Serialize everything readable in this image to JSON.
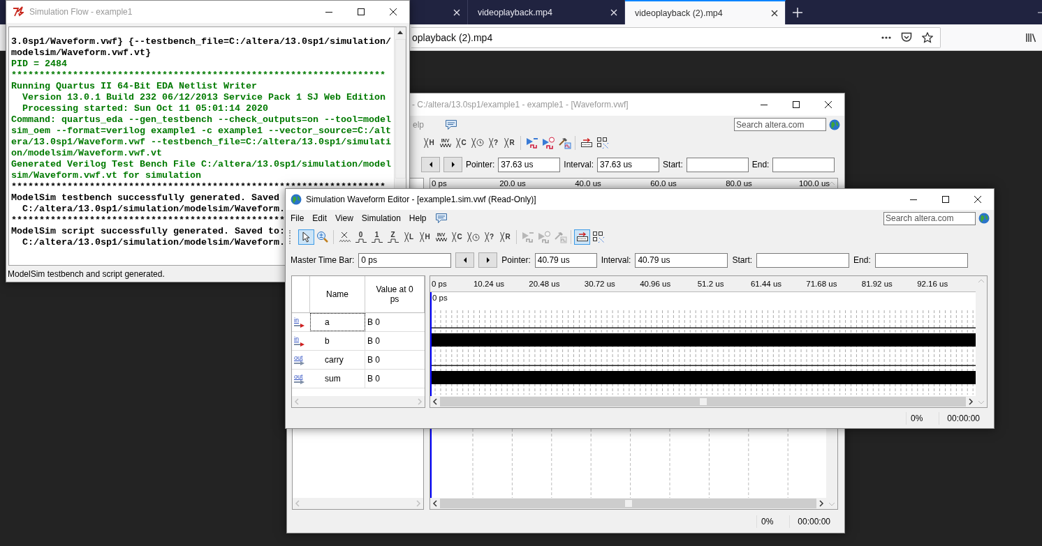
{
  "browser": {
    "tabs": [
      {
        "selected": false
      },
      {
        "label": "videoplayback.mp4",
        "selected": false
      },
      {
        "label": "videoplayback (2).mp4",
        "selected": true
      }
    ],
    "url": "oplayback (2).mp4"
  },
  "back_window": {
    "title": "- C:/altera/13.0sp1/example1 - example1 - [Waveform.vwf]",
    "menu": [
      "elp"
    ],
    "search": {
      "placeholder": "Search altera.com"
    },
    "toolbar": [
      {
        "kind": "letter",
        "glyph": "H",
        "selected": false,
        "disabled": false
      },
      {
        "kind": "invert",
        "glyph": "INV",
        "selected": false,
        "disabled": false
      },
      {
        "kind": "letter",
        "glyph": "C",
        "selected": false,
        "disabled": false
      },
      {
        "kind": "clock",
        "selected": false,
        "disabled": false
      },
      {
        "kind": "letter",
        "glyph": "?",
        "selected": false,
        "disabled": false
      },
      {
        "kind": "letter",
        "glyph": "R",
        "selected": false,
        "disabled": false
      },
      {
        "kind": "sep"
      },
      {
        "kind": "run-functional",
        "selected": false,
        "disabled": false
      },
      {
        "kind": "run-timing",
        "selected": false,
        "disabled": false
      },
      {
        "kind": "netlist",
        "selected": false,
        "disabled": false
      },
      {
        "kind": "sep"
      },
      {
        "kind": "snap",
        "selected": false,
        "disabled": false
      },
      {
        "kind": "grid",
        "selected": false,
        "disabled": false
      }
    ],
    "timebar": [
      {
        "kind": "prev"
      },
      {
        "kind": "next"
      },
      {
        "kind": "label",
        "text": "Pointer:"
      },
      {
        "kind": "field",
        "value": "37.63 us"
      },
      {
        "kind": "label",
        "text": "Interval:"
      },
      {
        "kind": "field",
        "value": "37.63 us"
      },
      {
        "kind": "label",
        "text": "Start:"
      },
      {
        "kind": "field"
      },
      {
        "kind": "label",
        "text": "End:"
      },
      {
        "kind": "field"
      }
    ],
    "ruler": [
      "0 ps",
      "20.0 us",
      "40.0 us",
      "60.0 us",
      "80.0 us",
      "100.0 us"
    ],
    "status": [
      "0%",
      "00:00:00"
    ]
  },
  "flow_window": {
    "title": "Simulation Flow - example1",
    "log": [
      {
        "kind": "plain",
        "text": "3.0sp1/Waveform.vwf} {--testbench_file=C:/altera/13.0sp1/simulation/"
      },
      {
        "kind": "plain",
        "text": "modelsim/Waveform.vwf.vt}"
      },
      {
        "kind": "info",
        "text": "PID = 2484"
      },
      {
        "kind": "info",
        "text": "*******************************************************************"
      },
      {
        "kind": "info",
        "text": "Running Quartus II 64-Bit EDA Netlist Writer"
      },
      {
        "kind": "info",
        "text": "  Version 13.0.1 Build 232 06/12/2013 Service Pack 1 SJ Web Edition"
      },
      {
        "kind": "info",
        "text": "  Processing started: Sun Oct 11 05:01:14 2020"
      },
      {
        "kind": "info",
        "text": "Command: quartus_eda --gen_testbench --check_outputs=on --tool=model"
      },
      {
        "kind": "info",
        "text": "sim_oem --format=verilog example1 -c example1 --vector_source=C:/alt"
      },
      {
        "kind": "info",
        "text": "era/13.0sp1/Waveform.vwf --testbench_file=C:/altera/13.0sp1/simulati"
      },
      {
        "kind": "info",
        "text": "on/modelsim/Waveform.vwf.vt"
      },
      {
        "kind": "info",
        "text": "Generated Verilog Test Bench File C:/altera/13.0sp1/simulation/model"
      },
      {
        "kind": "info",
        "text": "sim/Waveform.vwf.vt for simulation"
      },
      {
        "kind": "plain",
        "text": "*******************************************************************"
      },
      {
        "kind": "plain",
        "text": "ModelSim testbench successfully generated. Saved"
      },
      {
        "kind": "plain",
        "text": "  C:/altera/13.0sp1/simulation/modelsim/Waveform."
      },
      {
        "kind": "plain",
        "text": "*************************************************"
      },
      {
        "kind": "plain",
        "text": "ModelSim script successfully generated. Saved to:"
      },
      {
        "kind": "plain",
        "text": "  C:/altera/13.0sp1/simulation/modelsim/Waveform."
      }
    ],
    "status": "ModelSim testbench and script generated."
  },
  "editor_window": {
    "title": "Simulation Waveform Editor - [example1.sim.vwf (Read-Only)]",
    "menu": [
      "File",
      "Edit",
      "View",
      "Simulation",
      "Help"
    ],
    "search": {
      "placeholder": "Search altera.com"
    },
    "toolbar": [
      {
        "kind": "pointer",
        "selected": true,
        "disabled": false
      },
      {
        "kind": "zoom",
        "selected": false,
        "disabled": false
      },
      {
        "kind": "sep"
      },
      {
        "kind": "unknown",
        "selected": false,
        "disabled": false
      },
      {
        "kind": "level",
        "glyph": "0",
        "selected": false,
        "disabled": false
      },
      {
        "kind": "level",
        "glyph": "1",
        "selected": false,
        "disabled": false
      },
      {
        "kind": "level",
        "glyph": "Z",
        "selected": false,
        "disabled": false
      },
      {
        "kind": "letter",
        "glyph": "L",
        "selected": false,
        "disabled": false
      },
      {
        "kind": "letter",
        "glyph": "H",
        "selected": false,
        "disabled": false
      },
      {
        "kind": "invert",
        "glyph": "INV",
        "selected": false,
        "disabled": false
      },
      {
        "kind": "letter",
        "glyph": "C",
        "selected": false,
        "disabled": false
      },
      {
        "kind": "clock",
        "selected": false,
        "disabled": false
      },
      {
        "kind": "letter",
        "glyph": "?",
        "selected": false,
        "disabled": false
      },
      {
        "kind": "letter",
        "glyph": "R",
        "selected": false,
        "disabled": false
      },
      {
        "kind": "sep"
      },
      {
        "kind": "run-functional",
        "selected": false,
        "disabled": true
      },
      {
        "kind": "run-timing",
        "selected": false,
        "disabled": true
      },
      {
        "kind": "netlist",
        "selected": false,
        "disabled": true
      },
      {
        "kind": "sep"
      },
      {
        "kind": "snap",
        "selected": true,
        "disabled": false
      },
      {
        "kind": "grid",
        "selected": false,
        "disabled": false
      }
    ],
    "timebar": [
      {
        "kind": "label",
        "text": "Master Time Bar:"
      },
      {
        "kind": "field",
        "value": "0 ps"
      },
      {
        "kind": "prev"
      },
      {
        "kind": "next"
      },
      {
        "kind": "label",
        "text": "Pointer:"
      },
      {
        "kind": "field",
        "value": "40.79 us"
      },
      {
        "kind": "label",
        "text": "Interval:"
      },
      {
        "kind": "field",
        "value": "40.79 us"
      },
      {
        "kind": "label",
        "text": "Start:"
      },
      {
        "kind": "field"
      },
      {
        "kind": "label",
        "text": "End:"
      },
      {
        "kind": "field"
      }
    ],
    "columns": [
      "Name",
      "Value at 0 ps"
    ],
    "signals": [
      {
        "direction": "in",
        "name": "a",
        "value": "B 0",
        "kind": "flat",
        "focused": true
      },
      {
        "direction": "in",
        "name": "b",
        "value": "B 0",
        "kind": "toggling",
        "focused": false
      },
      {
        "direction": "out",
        "name": "carry",
        "value": "B 0",
        "kind": "flat",
        "focused": false
      },
      {
        "direction": "out",
        "name": "sum",
        "value": "B 0",
        "kind": "toggling",
        "focused": false
      }
    ],
    "ruler": [
      "0 ps",
      "10.24 us",
      "20.48 us",
      "30.72 us",
      "40.96 us",
      "51.2 us",
      "61.44 us",
      "71.68 us",
      "81.92 us",
      "92.16 us"
    ],
    "cursor_label": "0 ps",
    "status": [
      "0%",
      "00:00:00"
    ]
  }
}
